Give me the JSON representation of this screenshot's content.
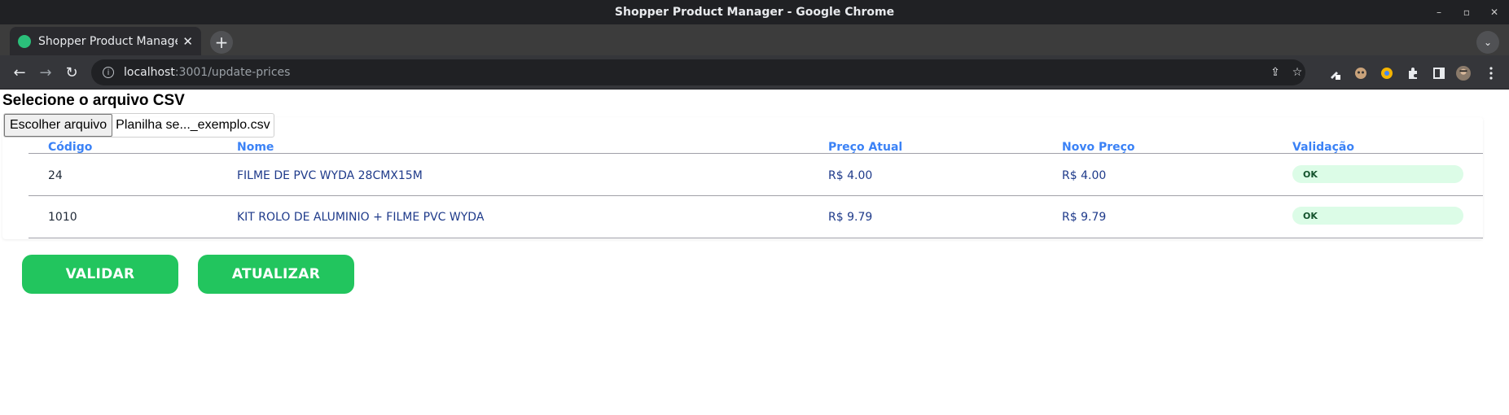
{
  "window": {
    "title": "Shopper Product Manager - Google Chrome",
    "controls": [
      "–",
      "▫",
      "✕"
    ]
  },
  "tab": {
    "title": "Shopper Product Manager",
    "close_glyph": "✕",
    "favicon": "shopper-leaf-icon"
  },
  "newtab_glyph": "+",
  "tabsearch_glyph": "⌄",
  "toolbar": {
    "back_glyph": "←",
    "forward_glyph": "→",
    "reload_glyph": "↻",
    "url_host": "localhost",
    "url_rest": ":3001/update-prices",
    "info_glyph": "i",
    "share_glyph": "⇪",
    "bookmark_glyph": "☆"
  },
  "page": {
    "heading": "Selecione o arquivo CSV",
    "file_button": "Escolher arquivo",
    "file_name": "Planilha se..._exemplo.csv",
    "table": {
      "headers": [
        "Código",
        "Nome",
        "Preço Atual",
        "Novo Preço",
        "Validação"
      ],
      "rows": [
        {
          "code": "24",
          "name": "FILME DE PVC WYDA 28CMX15M",
          "current": "R$ 4.00",
          "new": "R$ 4.00",
          "status": "OK"
        },
        {
          "code": "1010",
          "name": "KIT ROLO DE ALUMINIO + FILME PVC WYDA",
          "current": "R$ 9.79",
          "new": "R$ 9.79",
          "status": "OK"
        }
      ]
    },
    "validate_button": "VALIDAR",
    "update_button": "ATUALIZAR"
  },
  "colors": {
    "accent_green": "#22c55e",
    "header_blue": "#3b82f6",
    "status_bg": "#dcfce7"
  }
}
